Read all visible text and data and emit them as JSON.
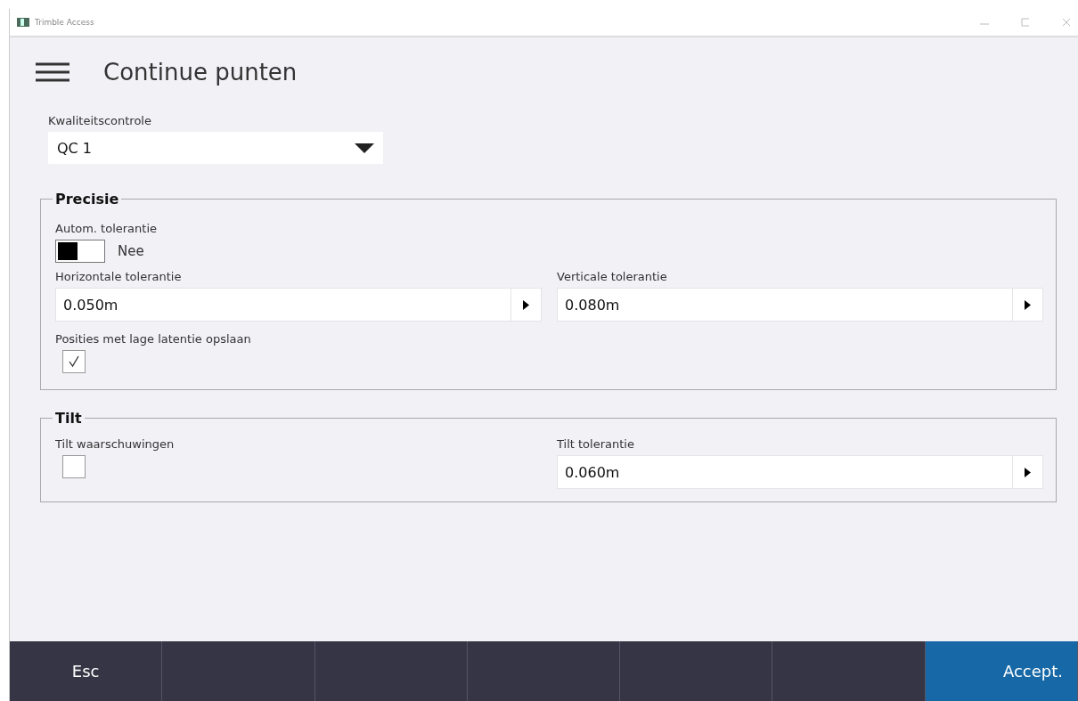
{
  "window": {
    "title": "Trimble Access"
  },
  "header": {
    "title": "Continue punten"
  },
  "quality": {
    "label": "Kwaliteitscontrole",
    "value": "QC 1"
  },
  "precision": {
    "legend": "Precisie",
    "auto": {
      "label": "Autom. tolerantie",
      "on": false,
      "state_text": "Nee"
    },
    "fields": [
      {
        "label": "Horizontale tolerantie",
        "value": "0.050m"
      },
      {
        "label": "Verticale tolerantie",
        "value": "0.080m"
      }
    ],
    "low_latency": {
      "label": "Posities met lage latentie opslaan",
      "checked": true
    }
  },
  "tilt": {
    "legend": "Tilt",
    "warnings": {
      "label": "Tilt waarschuwingen",
      "checked": false
    },
    "tolerance": {
      "label": "Tilt tolerantie",
      "value": "0.060m"
    }
  },
  "footer": [
    {
      "label": "Esc",
      "kind": "plain"
    },
    {
      "kind": "empty"
    },
    {
      "kind": "empty"
    },
    {
      "kind": "empty"
    },
    {
      "kind": "empty"
    },
    {
      "kind": "empty"
    },
    {
      "label": "Accept.",
      "kind": "primary"
    }
  ]
}
